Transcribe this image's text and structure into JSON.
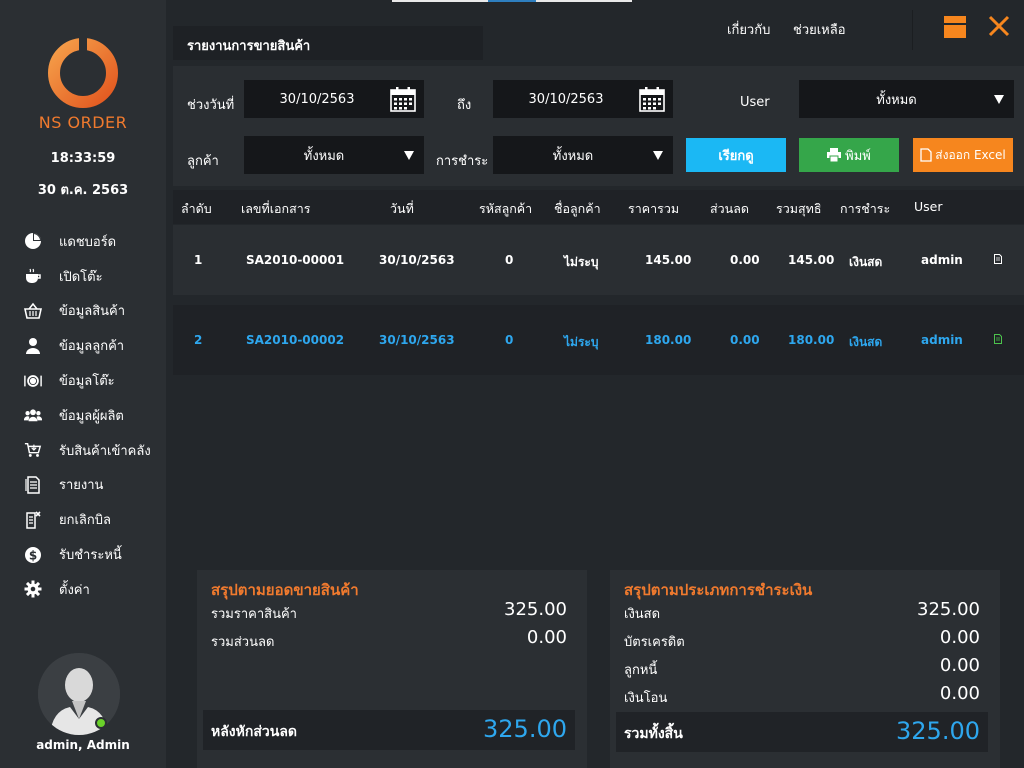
{
  "sidebar": {
    "brand": "NS ORDER",
    "clock": "18:33:59",
    "date": "30 ต.ค. 2563",
    "menu": [
      {
        "label": "แดชบอร์ด",
        "icon": "pie-chart-icon"
      },
      {
        "label": "เปิดโต๊ะ",
        "icon": "coffee-cup-icon"
      },
      {
        "label": "ข้อมูลสินค้า",
        "icon": "basket-icon"
      },
      {
        "label": "ข้อมูลลูกค้า",
        "icon": "person-icon"
      },
      {
        "label": "ข้อมูลโต๊ะ",
        "icon": "plate-icon"
      },
      {
        "label": "ข้อมูลผู้ผลิต",
        "icon": "group-icon"
      },
      {
        "label": "รับสินค้าเข้าคลัง",
        "icon": "cart-icon"
      },
      {
        "label": "รายงาน",
        "icon": "document-icon"
      },
      {
        "label": "ยกเลิกบิล",
        "icon": "cancel-doc-icon"
      },
      {
        "label": "รับชำระหนี้",
        "icon": "dollar-coin-icon"
      },
      {
        "label": "ตั้งค่า",
        "icon": "gear-icon"
      }
    ],
    "user": "admin, Admin"
  },
  "header": {
    "title": "รายงานการขายสินค้า",
    "about": "เกี่ยวกับ",
    "help": "ช่วยเหลือ"
  },
  "filters": {
    "date_range_label": "ช่วงวันที่",
    "date_from": "30/10/2563",
    "to_label": "ถึง",
    "date_to": "30/10/2563",
    "user_label": "User",
    "user_value": "ทั้งหมด",
    "customer_label": "ลูกค้า",
    "customer_value": "ทั้งหมด",
    "payment_label": "การชำระ",
    "payment_value": "ทั้งหมด",
    "search_btn": "เรียกดู",
    "print_btn": "พิมพ์",
    "excel_btn": "ส่งออก Excel"
  },
  "table": {
    "headers": [
      "ลำดับ",
      "เลขที่เอกสาร",
      "วันที่",
      "รหัสลูกค้า",
      "ชื่อลูกค้า",
      "ราคารวม",
      "ส่วนลด",
      "รวมสุทธิ",
      "การชำระ",
      "User"
    ],
    "rows": [
      {
        "no": "1",
        "doc": "SA2010-00001",
        "date": "30/10/2563",
        "cust_code": "0",
        "cust_name": "ไม่ระบุ",
        "total": "145.00",
        "discount": "0.00",
        "net": "145.00",
        "payment": "เงินสด",
        "user": "admin"
      },
      {
        "no": "2",
        "doc": "SA2010-00002",
        "date": "30/10/2563",
        "cust_code": "0",
        "cust_name": "ไม่ระบุ",
        "total": "180.00",
        "discount": "0.00",
        "net": "180.00",
        "payment": "เงินสด",
        "user": "admin"
      }
    ]
  },
  "summary_sales": {
    "title": "สรุปตามยอดขายสินค้า",
    "rows": [
      {
        "label": "รวมราคาสินค้า",
        "value": "325.00"
      },
      {
        "label": "รวมส่วนลด",
        "value": "0.00"
      }
    ],
    "total_label": "หลังหักส่วนลด",
    "total_value": "325.00"
  },
  "summary_payment": {
    "title": "สรุปตามประเภทการชำระเงิน",
    "rows": [
      {
        "label": "เงินสด",
        "value": "325.00"
      },
      {
        "label": "บัตรเครดิต",
        "value": "0.00"
      },
      {
        "label": "ลูกหนี้",
        "value": "0.00"
      },
      {
        "label": "เงินโอน",
        "value": "0.00"
      }
    ],
    "total_label": "รวมทั้งสิ้น",
    "total_value": "325.00"
  },
  "colors": {
    "accent_orange": "#f07a2e",
    "accent_blue": "#2ea7ee",
    "search_button": "#1bb8f4",
    "print_button": "#35a64a",
    "excel_button": "#f6861e",
    "online": "#6ad12a"
  }
}
